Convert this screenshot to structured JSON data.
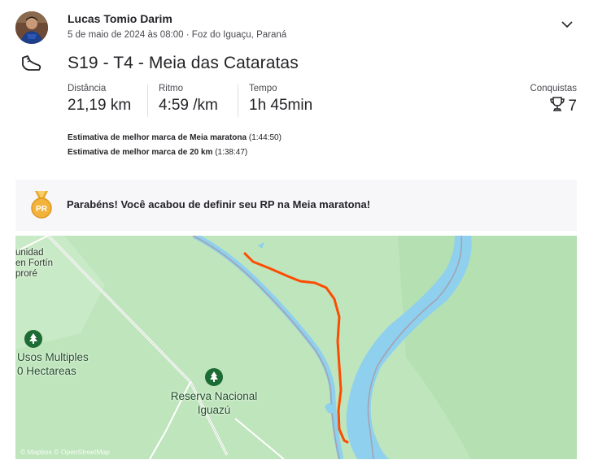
{
  "athlete": {
    "name": "Lucas Tomio Darim",
    "meta": "5 de maio de 2024 às 08:00 · Foz do Iguaçu, Paraná"
  },
  "activity": {
    "title": "S19 - T4 - Meia das Cataratas",
    "sport_icon": "running-shoe-icon"
  },
  "stats": [
    {
      "label": "Distância",
      "value": "21,19 km"
    },
    {
      "label": "Ritmo",
      "value": "4:59 /km"
    },
    {
      "label": "Tempo",
      "value": "1h 45min"
    }
  ],
  "achievements": {
    "label": "Conquistas",
    "count": "7",
    "icon": "trophy-icon"
  },
  "best_efforts": [
    {
      "label": "Estimativa de melhor marca de Meia maratona",
      "value": "(1:44:50)"
    },
    {
      "label": "Estimativa de melhor marca de 20 km",
      "value": "(1:38:47)"
    }
  ],
  "pr_banner": {
    "badge": "PR",
    "text": "Parabéns! Você acabou de definir seu RP na Meia maratona!"
  },
  "map": {
    "labels": {
      "top_left": [
        "unidad",
        "en Fortín",
        "proré"
      ],
      "usos": [
        "Usos Multiples",
        "0 Hectareas"
      ],
      "reserva": [
        "Reserva Nacional",
        "Iguazú"
      ]
    },
    "attribution": "© Mapbox © OpenStreetMap",
    "route_color": "#fc4c02",
    "land_color": "#bfe5bc",
    "water_color": "#8fd0ee"
  }
}
